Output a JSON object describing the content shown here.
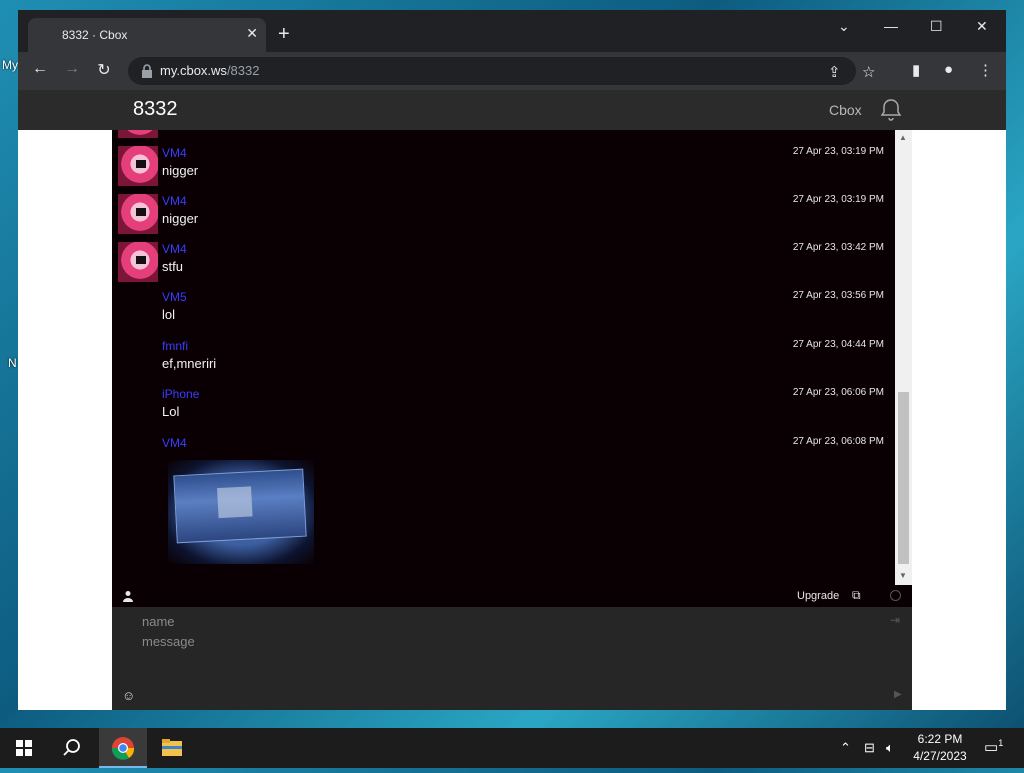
{
  "desktop": {
    "label_top": "My",
    "label_mid": "N"
  },
  "browser": {
    "tab_title": "8332 · Cbox",
    "tab_close": "✕",
    "new_tab": "+",
    "url_host": "my.cbox.ws",
    "url_path": "/8332"
  },
  "cbox": {
    "room_title": "8332",
    "brand": "Cbox",
    "messages": [
      {
        "user": "VM4",
        "text": "nigger",
        "time": "27 Apr 23, 03:19 PM",
        "avatar": true
      },
      {
        "user": "VM4",
        "text": "nigger",
        "time": "27 Apr 23, 03:19 PM",
        "avatar": true
      },
      {
        "user": "VM4",
        "text": "stfu",
        "time": "27 Apr 23, 03:42 PM",
        "avatar": true
      },
      {
        "user": "VM5",
        "text": "lol",
        "time": "27 Apr 23, 03:56 PM",
        "avatar": false
      },
      {
        "user": "fmnfi",
        "text": "ef,mneriri",
        "time": "27 Apr 23, 04:44 PM",
        "avatar": false
      },
      {
        "user": "iPhone",
        "text": "Lol",
        "time": "27 Apr 23, 06:06 PM",
        "avatar": false
      },
      {
        "user": "VM4",
        "text": "",
        "time": "27 Apr 23, 06:08 PM",
        "avatar": false
      }
    ],
    "upgrade_label": "Upgrade",
    "name_placeholder": "name",
    "message_placeholder": "message"
  },
  "taskbar": {
    "time": "6:22 PM",
    "date": "4/27/2023",
    "notification_count": "1"
  },
  "icons": {
    "back": "back-arrow-icon",
    "forward": "forward-arrow-icon",
    "reload": "reload-icon",
    "bell": "bell-icon",
    "smiley": "smiley-icon",
    "popout": "external-link-icon"
  },
  "colors": {
    "username": "#3b3bff",
    "chat_bg": "#0a0003",
    "header_bg": "#2b2b2b",
    "form_bg": "#262626"
  }
}
